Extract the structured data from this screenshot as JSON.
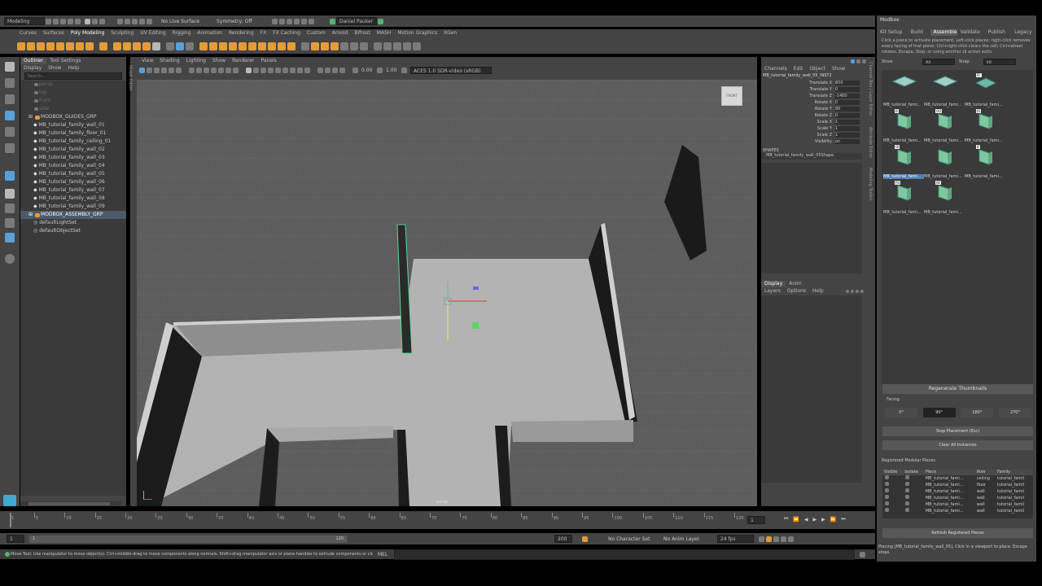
{
  "menubar": {
    "workspace": "Modeling",
    "live_surface": "No Live Surface",
    "symmetry": "Symmetry: Off",
    "user": "Daniel Pauker"
  },
  "shelf_tabs": [
    "Curves",
    "Surfaces",
    "Poly Modeling",
    "Sculpting",
    "UV Editing",
    "Rigging",
    "Animation",
    "Rendering",
    "FX",
    "FX Caching",
    "Custom",
    "Arnold",
    "Bifrost",
    "MASH",
    "Motion Graphics",
    "XGen"
  ],
  "shelf_active_index": 2,
  "outliner": {
    "tabs": [
      "Outliner",
      "Tool Settings"
    ],
    "menu": [
      "Display",
      "Show",
      "Help"
    ],
    "search_placeholder": "Search...",
    "cameras": [
      "persp",
      "top",
      "front",
      "side"
    ],
    "items": [
      {
        "name": "MODBOX_GUIDES_GRP",
        "type": "group"
      },
      {
        "name": "MB_tutorial_family_wall_01",
        "type": "mesh"
      },
      {
        "name": "MB_tutorial_family_floor_01",
        "type": "mesh"
      },
      {
        "name": "MB_tutorial_family_ceiling_01",
        "type": "mesh"
      },
      {
        "name": "MB_tutorial_family_wall_02",
        "type": "mesh"
      },
      {
        "name": "MB_tutorial_family_wall_03",
        "type": "mesh"
      },
      {
        "name": "MB_tutorial_family_wall_04",
        "type": "mesh"
      },
      {
        "name": "MB_tutorial_family_wall_05",
        "type": "mesh"
      },
      {
        "name": "MB_tutorial_family_wall_06",
        "type": "mesh"
      },
      {
        "name": "MB_tutorial_family_wall_07",
        "type": "mesh"
      },
      {
        "name": "MB_tutorial_family_wall_08",
        "type": "mesh"
      },
      {
        "name": "MB_tutorial_family_wall_09",
        "type": "mesh"
      },
      {
        "name": "MODBOX_ASSEMBLY_GRP",
        "type": "group"
      },
      {
        "name": "defaultLightSet",
        "type": "set"
      },
      {
        "name": "defaultObjectSet",
        "type": "set"
      }
    ],
    "selected_index": 12
  },
  "viewport": {
    "menu": [
      "View",
      "Shading",
      "Lighting",
      "Show",
      "Renderer",
      "Panels"
    ],
    "exposure": "0.00",
    "gamma": "1.00",
    "colorspace": "ACES 1.0 SDR-video (sRGB)",
    "camera_label": "persp",
    "viewcube_label": "FRONT"
  },
  "channel_box": {
    "menu": [
      "Channels",
      "Edit",
      "Object",
      "Show"
    ],
    "object": "MB_tutorial_family_wall_05_INST2",
    "attributes": [
      {
        "name": "Translate X",
        "value": "800"
      },
      {
        "name": "Translate Y",
        "value": "0"
      },
      {
        "name": "Translate Z",
        "value": "-1400"
      },
      {
        "name": "Rotate X",
        "value": "0"
      },
      {
        "name": "Rotate Y",
        "value": "90"
      },
      {
        "name": "Rotate Z",
        "value": "0"
      },
      {
        "name": "Scale X",
        "value": "1"
      },
      {
        "name": "Scale Y",
        "value": "1"
      },
      {
        "name": "Scale Z",
        "value": "1"
      },
      {
        "name": "Visibility",
        "value": "on"
      }
    ],
    "shapes_label": "SHAPES",
    "shape_name": "MB_tutorial_family_wall_05Shape",
    "side_tabs": [
      "Channel Box / Layer Editor",
      "Attribute Editor",
      "Modeling Toolkit"
    ]
  },
  "layer_editor": {
    "tabs": [
      "Display",
      "Anim"
    ],
    "menu": [
      "Layers",
      "Options",
      "Help"
    ]
  },
  "modbox": {
    "title": "Modbox",
    "tabs": [
      "Kit Setup",
      "Build",
      "Assemble",
      "Validate",
      "Publish",
      "Legacy"
    ],
    "active_tab_index": 2,
    "instructions": "Click a piece to activate placement. Left-click places; right-click removes every facing of that piece; Ctrl+right-click clears the cell; Ctrl+wheel rotates. Escape, Stop, or using another UI action exits.",
    "show_label": "Show",
    "show_value": "All",
    "snap_label": "Snap",
    "snap_value": "kit",
    "thumbnails": [
      {
        "label": "MB_tutorial_fami...",
        "badge": "",
        "kind": "floor"
      },
      {
        "label": "MB_tutorial_fami...",
        "badge": "",
        "kind": "floor"
      },
      {
        "label": "MB_tutorial_fami...",
        "badge": "FF",
        "kind": "ceiling"
      },
      {
        "label": "MB_tutorial_fami...",
        "badge": "B",
        "kind": "wall"
      },
      {
        "label": "MB_tutorial_fami...",
        "badge": "OO",
        "kind": "wall"
      },
      {
        "label": "MB_tutorial_fami...",
        "badge": "IO",
        "kind": "wall"
      },
      {
        "label": "MB_tutorial_fami...",
        "badge": "OI",
        "kind": "wall"
      },
      {
        "label": "MB_tutorial_fami...",
        "badge": "",
        "kind": "wall"
      },
      {
        "label": "MB_tutorial_fami...",
        "badge": "IF",
        "kind": "wall"
      },
      {
        "label": "MB_tutorial_fami...",
        "badge": "FO",
        "kind": "wall"
      },
      {
        "label": "MB_tutorial_fami...",
        "badge": "OF",
        "kind": "wall"
      }
    ],
    "selected_thumbnail": 6,
    "regenerate_label": "Regenerate Thumbnails",
    "facing_label": "Facing",
    "facings": [
      "0°",
      "90°",
      "180°",
      "270°"
    ],
    "active_facing": 1,
    "stop_label": "Stop Placement (Esc)",
    "clear_label": "Clear All Instances",
    "registered_label": "Registered Modular Pieces",
    "registered_headers": [
      "Visible",
      "Isolate",
      "Piece",
      "Role",
      "Family"
    ],
    "registered_rows": [
      {
        "piece": "MB_tutorial_fami...",
        "role": "ceiling",
        "family": "tutorial_famil"
      },
      {
        "piece": "MB_tutorial_fami...",
        "role": "floor",
        "family": "tutorial_famil"
      },
      {
        "piece": "MB_tutorial_fami...",
        "role": "wall",
        "family": "tutorial_famil"
      },
      {
        "piece": "MB_tutorial_fami...",
        "role": "wall",
        "family": "tutorial_famil"
      },
      {
        "piece": "MB_tutorial_fami...",
        "role": "wall",
        "family": "tutorial_famil"
      },
      {
        "piece": "MB_tutorial_fami...",
        "role": "wall",
        "family": "tutorial_famil"
      }
    ],
    "refresh_label": "Refresh Registered Pieces",
    "status": "Placing [MB_tutorial_family_wall_05]. Click in a viewport to place. Escape stops."
  },
  "timeline": {
    "ticks": [
      "1",
      "5",
      "10",
      "15",
      "20",
      "25",
      "30",
      "35",
      "40",
      "45",
      "50",
      "55",
      "60",
      "65",
      "70",
      "75",
      "80",
      "85",
      "90",
      "95",
      "100",
      "105",
      "110",
      "115",
      "120"
    ],
    "current_frame": "1",
    "range_start": "1",
    "range_start2": "1",
    "range_end": "120",
    "range_end2": "200",
    "char_set": "No Character Set",
    "anim_layer": "No Anim Layer",
    "fps": "24 fps"
  },
  "helpline": {
    "text": "Move Tool: Use manipulator to move object(s). Ctrl+middle-drag to move components along normals. Shift+drag manipulator axis or plane handles to extrude components or clone objects. Ctrl+Sh",
    "mel": "MEL"
  },
  "colors": {
    "panel": "#444444",
    "viewport_bg": "#5d5d5d",
    "accent_orange": "#e49b3a",
    "selection_blue": "#4c7ab8",
    "highlight_green": "#5fd49a"
  }
}
